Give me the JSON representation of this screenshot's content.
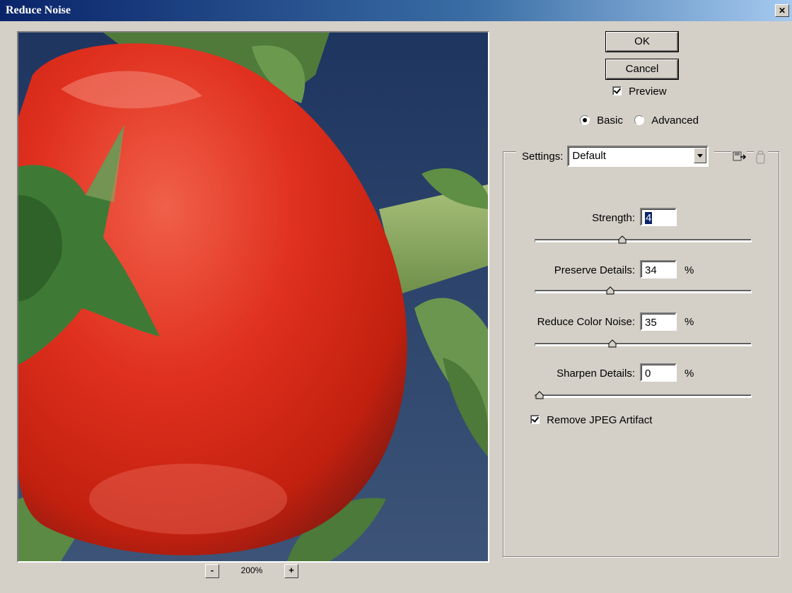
{
  "window": {
    "title": "Reduce Noise"
  },
  "buttons": {
    "ok": "OK",
    "cancel": "Cancel"
  },
  "preview_checkbox": {
    "label": "Preview",
    "checked": true
  },
  "mode": {
    "basic": "Basic",
    "advanced": "Advanced",
    "selected": "Basic"
  },
  "settings": {
    "label": "Settings:",
    "value": "Default"
  },
  "controls": {
    "strength": {
      "label": "Strength:",
      "value": "4",
      "unit": "",
      "fraction": 0.4
    },
    "preserve_details": {
      "label": "Preserve Details:",
      "value": "34",
      "unit": "%",
      "fraction": 0.34
    },
    "reduce_color_noise": {
      "label": "Reduce Color Noise:",
      "value": "35",
      "unit": "%",
      "fraction": 0.35
    },
    "sharpen_details": {
      "label": "Sharpen Details:",
      "value": "0",
      "unit": "%",
      "fraction": 0.0
    }
  },
  "jpeg_checkbox": {
    "label": "Remove JPEG Artifact",
    "checked": true
  },
  "zoom": {
    "level": "200%",
    "minus": "-",
    "plus": "+"
  },
  "colors": {
    "title_start": "#0a246a",
    "title_end": "#a6caf0",
    "dialog_bg": "#d4d0c8"
  }
}
